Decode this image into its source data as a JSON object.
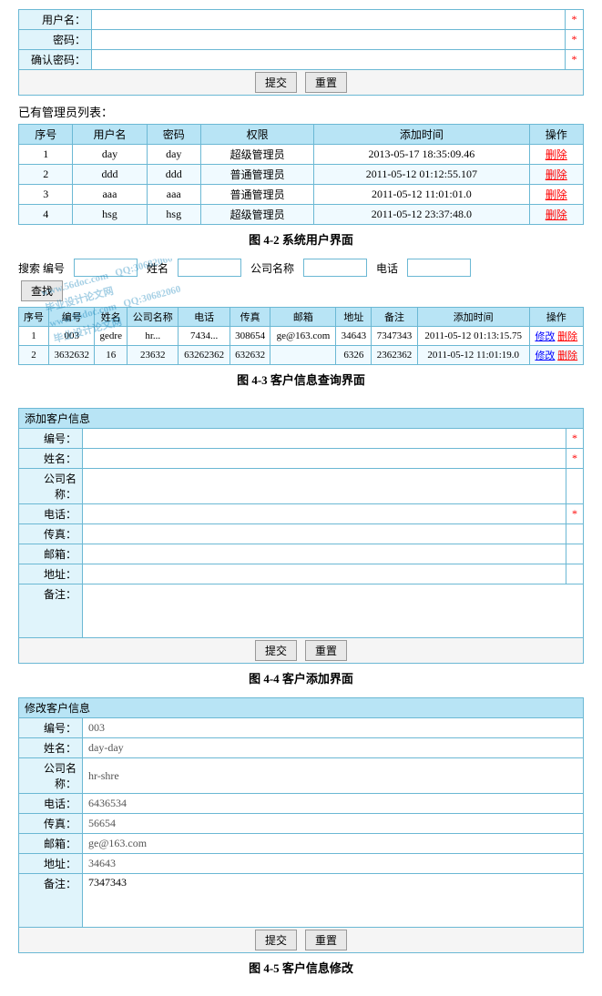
{
  "section1": {
    "title": "系统用户界面",
    "fig": "图 4-2  系统用户界面",
    "form_fields": [
      {
        "label": "用户名：",
        "star": "*"
      },
      {
        "label": "密码：",
        "star": "*"
      },
      {
        "label": "确认密码：",
        "star": "*"
      }
    ],
    "buttons": [
      "提交",
      "重置"
    ],
    "list_title": "已有管理员列表：",
    "table_headers": [
      "序号",
      "用户名",
      "密码",
      "权限",
      "添加时间",
      "操作"
    ],
    "table_rows": [
      {
        "id": "1",
        "username": "day",
        "password": "day",
        "role": "超级管理员",
        "time": "2013-05-17 18:35:09.46",
        "op": "删除"
      },
      {
        "id": "2",
        "username": "ddd",
        "password": "ddd",
        "role": "普通管理员",
        "time": "2011-05-12 01:12:55.107",
        "op": "删除"
      },
      {
        "id": "3",
        "username": "aaa",
        "password": "aaa",
        "role": "普通管理员",
        "time": "2011-05-12 11:01:01.0",
        "op": "删除"
      },
      {
        "id": "4",
        "username": "hsg",
        "password": "hsg",
        "role": "超级管理员",
        "time": "2011-05-12 23:37:48.0",
        "op": "删除"
      }
    ]
  },
  "section2": {
    "title": "客户信息查询界面",
    "fig": "图 4-3  客户信息查询界面",
    "search_labels": [
      "搜索 编号",
      "姓名",
      "公司名称",
      "电话"
    ],
    "search_button": "查找",
    "table_headers": [
      "序号",
      "编号",
      "姓名",
      "公司名称",
      "电话",
      "传真",
      "邮箱",
      "地址",
      "备注",
      "添加时间",
      "操作"
    ],
    "table_rows": [
      {
        "seq": "1",
        "num": "003",
        "name": "gedre",
        "company": "hr...",
        "phone": "7434...",
        "fax": "308654",
        "email": "ge@163.com",
        "addr": "34643",
        "note": "7347343",
        "time": "2011-05-12 01:13:15.75",
        "op1": "修改",
        "op2": "删除"
      },
      {
        "seq": "2",
        "num": "3632632",
        "name": "16",
        "company": "23632",
        "phone": "63262362",
        "fax": "632632",
        "email": "",
        "addr": "6326",
        "note": "2362362",
        "time": "2011-05-12 11:01:19.0",
        "op1": "修改",
        "op2": "删除"
      }
    ]
  },
  "section3": {
    "title": "客户添加界面",
    "fig": "图 4-4  客户添加界面",
    "form_title": "添加客户信息",
    "fields": [
      {
        "label": "编号：",
        "star": "*",
        "value": ""
      },
      {
        "label": "姓名：",
        "star": "*",
        "value": ""
      },
      {
        "label": "公司名称：",
        "star": "",
        "value": ""
      },
      {
        "label": "电话：",
        "star": "*",
        "value": ""
      },
      {
        "label": "传真：",
        "star": "",
        "value": ""
      },
      {
        "label": "邮箱：",
        "star": "",
        "value": ""
      },
      {
        "label": "地址：",
        "star": "",
        "value": ""
      }
    ],
    "note_label": "备注：",
    "buttons": [
      "提交",
      "重置"
    ]
  },
  "section4": {
    "title": "客户信息修改",
    "fig": "图 4-5  客户信息修改",
    "form_title": "修改客户信息",
    "fields": [
      {
        "label": "编号：",
        "value": "003"
      },
      {
        "label": "姓名：",
        "value": "day-day"
      },
      {
        "label": "公司名称：",
        "value": "hr-shre"
      },
      {
        "label": "电话：",
        "value": "6436534"
      },
      {
        "label": "传真：",
        "value": "56654"
      },
      {
        "label": "邮箱：",
        "value": "ge@163.com"
      },
      {
        "label": "地址：",
        "value": "34643"
      }
    ],
    "note_label": "备注：",
    "note_value": "7347343",
    "buttons": [
      "提交",
      "重置"
    ]
  },
  "watermark": {
    "lines": [
      "www.56doc.com  QQ:30682060",
      "毕业设计论文网",
      "www.56doc.com  QQ:30682060",
      "毕业设计论文网"
    ]
  }
}
